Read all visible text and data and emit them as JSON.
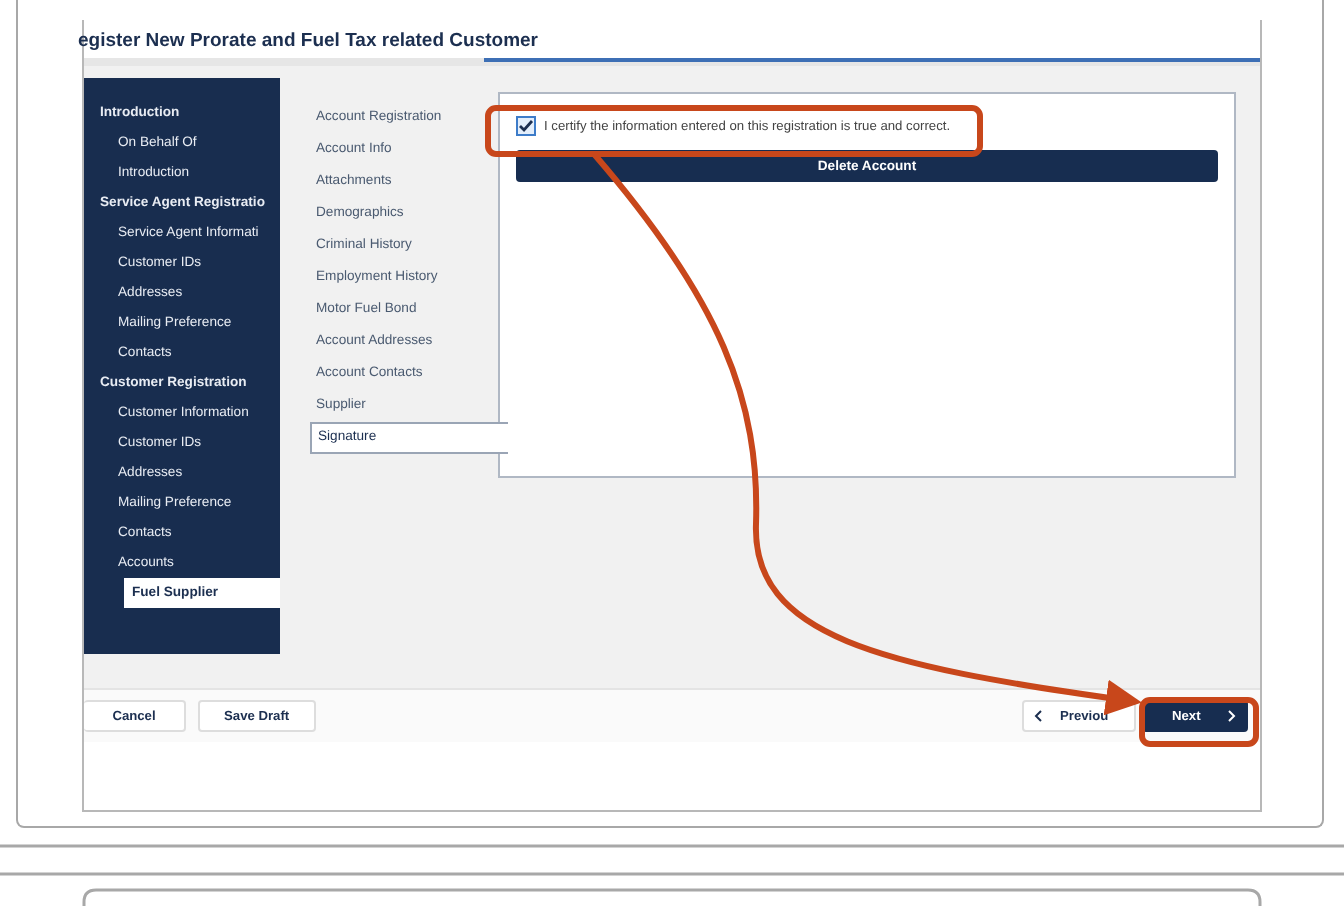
{
  "window": {
    "title": "egister New Prorate and Fuel Tax related Customer"
  },
  "sidebar": {
    "items": [
      {
        "label": "Introduction",
        "selected": false,
        "children": [
          {
            "label": "On Behalf Of",
            "selected": false
          },
          {
            "label": "Introduction",
            "selected": false
          }
        ]
      },
      {
        "label": "Service Agent Registratio",
        "selected": false,
        "children": [
          {
            "label": "Service Agent Informati",
            "selected": false
          },
          {
            "label": "Customer IDs",
            "selected": false
          },
          {
            "label": "Addresses",
            "selected": false
          },
          {
            "label": "Mailing Preference",
            "selected": false
          },
          {
            "label": "Contacts",
            "selected": false
          }
        ]
      },
      {
        "label": "Customer Registration",
        "selected": false,
        "children": [
          {
            "label": "Customer Information",
            "selected": false
          },
          {
            "label": "Customer IDs",
            "selected": false
          },
          {
            "label": "Addresses",
            "selected": false
          },
          {
            "label": "Mailing Preference",
            "selected": false
          },
          {
            "label": "Contacts",
            "selected": false
          },
          {
            "label": "Accounts",
            "selected": false,
            "children": [
              {
                "label": "Fuel Supplier",
                "selected": true
              }
            ]
          }
        ]
      }
    ]
  },
  "steps": [
    {
      "label": "Account Registration",
      "selected": false
    },
    {
      "label": "Account Info",
      "selected": false
    },
    {
      "label": "Attachments",
      "selected": false
    },
    {
      "label": "Demographics",
      "selected": false
    },
    {
      "label": "Criminal History",
      "selected": false
    },
    {
      "label": "Employment History",
      "selected": false
    },
    {
      "label": "Motor Fuel Bond",
      "selected": false
    },
    {
      "label": "Account Addresses",
      "selected": false
    },
    {
      "label": "Account Contacts",
      "selected": false
    },
    {
      "label": "Supplier",
      "selected": false
    },
    {
      "label": "Signature",
      "selected": true
    }
  ],
  "certification": {
    "label": "I certify the information entered on this registration is true and correct.",
    "checked": true
  },
  "delete_button": "Delete Account",
  "footer": {
    "left_buttons": [
      "Cancel",
      "Save Draft"
    ],
    "previous": "Previou",
    "next": "Next"
  }
}
